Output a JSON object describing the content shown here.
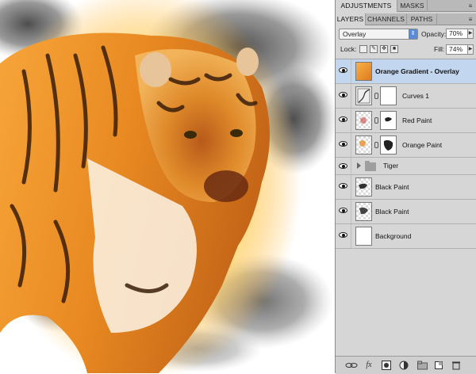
{
  "panel": {
    "top_tabs": [
      "ADJUSTMENTS",
      "MASKS"
    ],
    "layer_tabs": [
      "LAYERS",
      "CHANNELS",
      "PATHS"
    ],
    "blend_mode": "Overlay",
    "opacity_label": "Opacity:",
    "opacity_value": "70%",
    "lock_label": "Lock:",
    "fill_label": "Fill:",
    "fill_value": "74%",
    "layers": [
      {
        "name": "Orange Gradient - Overlay",
        "selected": true,
        "bold": true
      },
      {
        "name": "Curves 1",
        "selected": false
      },
      {
        "name": "Red Paint",
        "selected": false
      },
      {
        "name": "Orange Paint",
        "selected": false
      },
      {
        "name": "Tiger",
        "group": true
      },
      {
        "name": "Black Paint",
        "selected": false
      },
      {
        "name": "Black Paint",
        "selected": false
      },
      {
        "name": "Background",
        "selected": false
      }
    ],
    "bottom_icons": [
      "link-layers-icon",
      "fx-icon",
      "add-mask-icon",
      "adjustment-layer-icon",
      "new-group-icon",
      "new-layer-icon",
      "trash-icon"
    ],
    "fx_label": "fx"
  },
  "colors": {
    "selection": "#c2d6f0",
    "panel_bg": "#d6d6d6",
    "tiger_orange": "#e0801e"
  }
}
